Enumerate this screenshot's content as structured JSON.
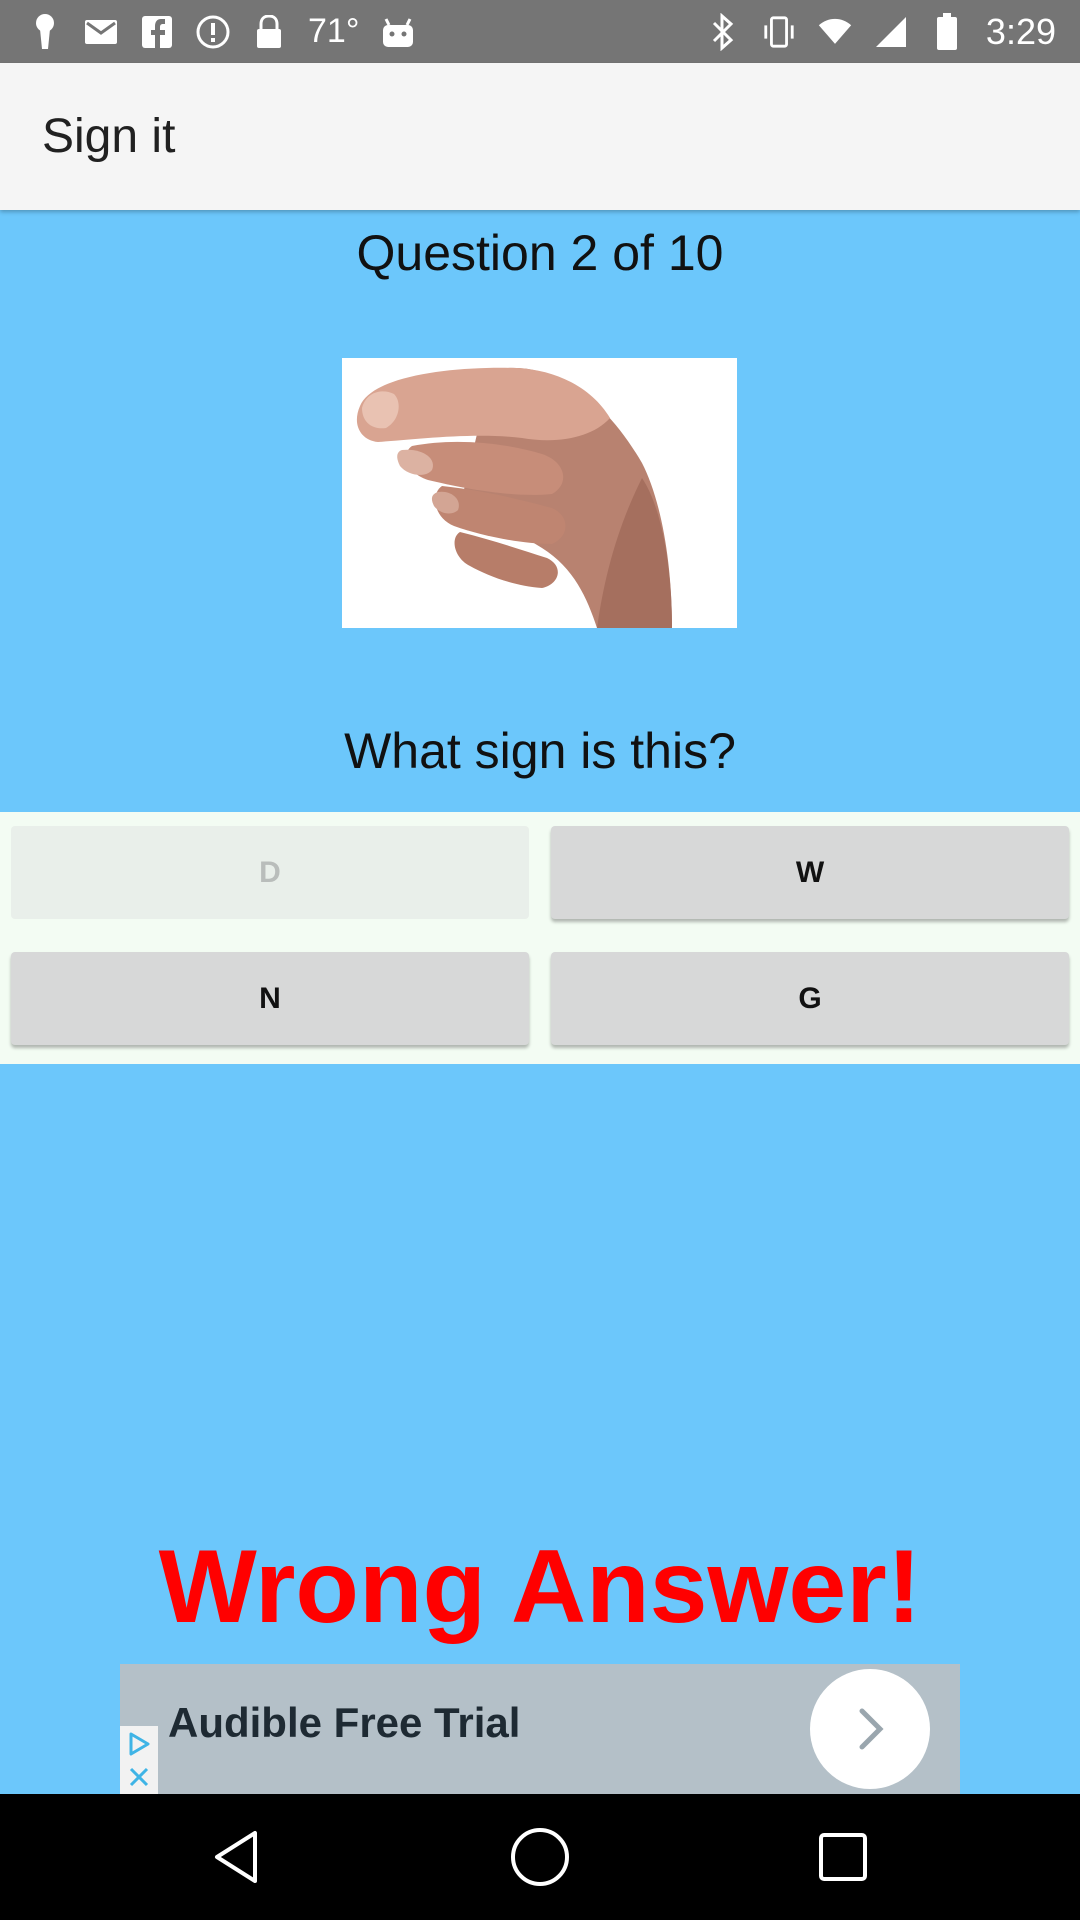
{
  "status_bar": {
    "temperature": "71°",
    "time": "3:29",
    "left_icons": [
      "keyhole-icon",
      "mail-icon",
      "facebook-icon",
      "info-icon",
      "lock-icon"
    ],
    "right_icons": [
      "bluetooth-icon",
      "vibrate-icon",
      "wifi-icon",
      "signal-icon",
      "battery-icon"
    ]
  },
  "app_bar": {
    "title": "Sign it"
  },
  "quiz": {
    "question_number": "Question 2 of 10",
    "image": "hand-sign-image",
    "question": "What sign is this?",
    "answers": [
      {
        "label": "D",
        "disabled": true
      },
      {
        "label": "W",
        "disabled": false
      },
      {
        "label": "N",
        "disabled": false
      },
      {
        "label": "G",
        "disabled": false
      }
    ],
    "result": "Wrong Answer!"
  },
  "ad": {
    "text": "Audible Free Trial"
  },
  "colors": {
    "background": "#6cc7fb",
    "answers_panel": "#f3fcf3",
    "button": "#d7d8d8",
    "result": "#ff0000",
    "status_bar": "#757575",
    "app_bar": "#f5f5f5"
  }
}
